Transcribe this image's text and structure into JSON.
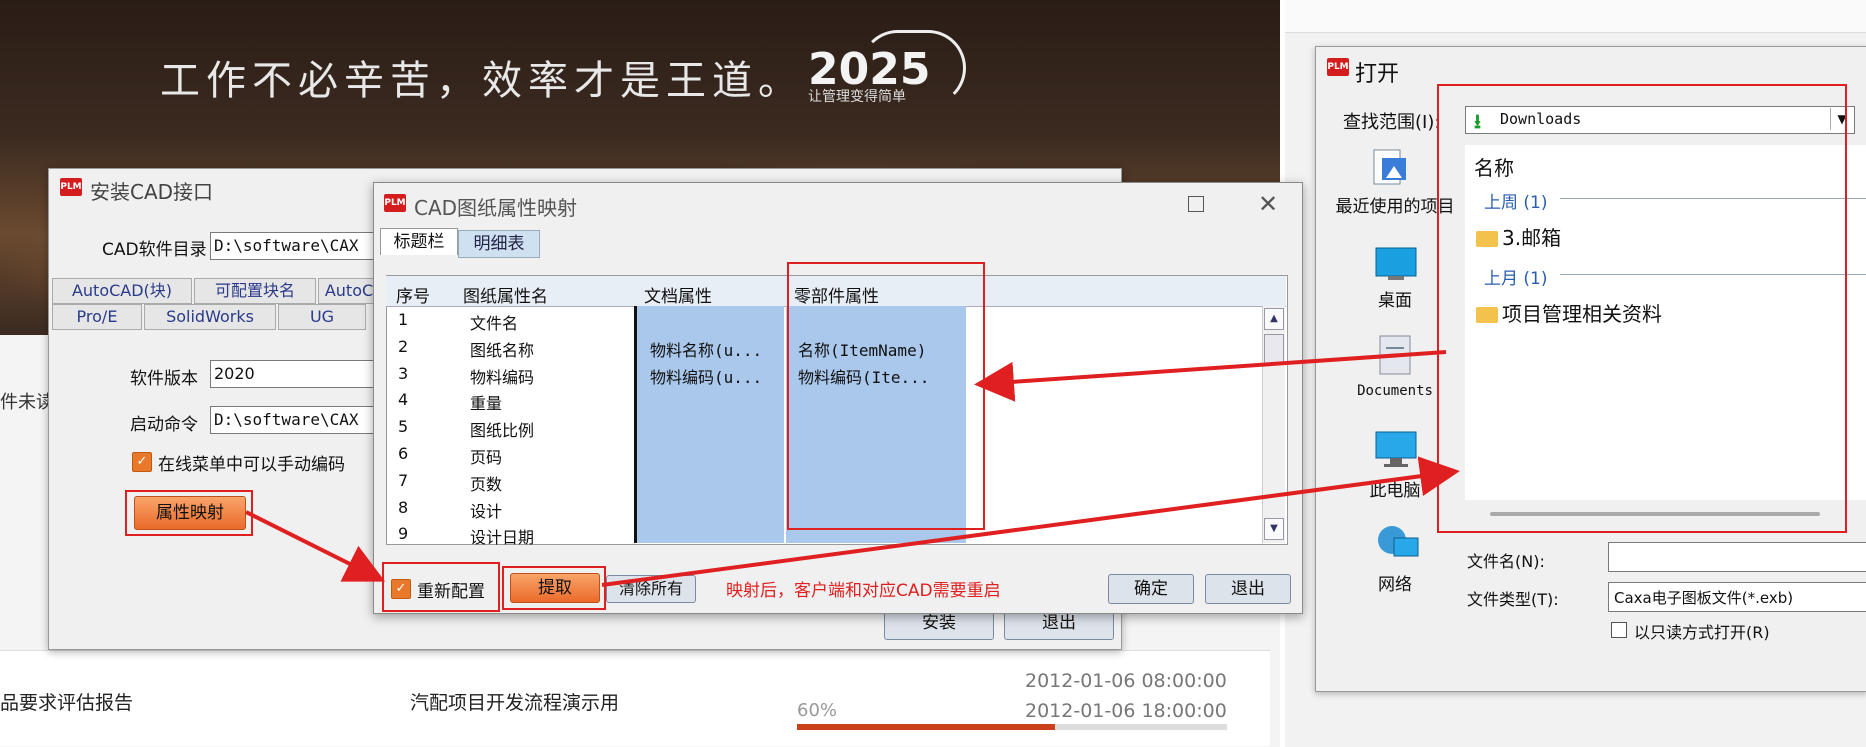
{
  "banner": {
    "slogan": "工作不必辛苦，效率才是王道。",
    "logo": "2025",
    "logo_sub": "让管理变得简单"
  },
  "background": {
    "left_item": "件未读",
    "row_col1": "品要求评估报告",
    "row_col2": "汽配项目开发流程演示用",
    "date1": "2012-01-06 08:00:00",
    "date2": "2012-01-06 18:00:00",
    "progress_label": "60%",
    "progress": 0.6,
    "accent": "#c9401a"
  },
  "open_dialog": {
    "title": "打开",
    "look_in_label": "查找范围(I):",
    "look_in_value": "Downloads",
    "places": [
      "最近使用的项目",
      "桌面",
      "Documents",
      "此电脑",
      "网络"
    ],
    "col_name": "名称",
    "group1": "上周 (1)",
    "folder1": "3.邮箱",
    "group2": "上月 (1)",
    "folder2": "项目管理相关资料",
    "filename_label": "文件名(N):",
    "filetype_label": "文件类型(T):",
    "filetype_value": "Caxa电子图板文件(*.exb)",
    "readonly_label": "以只读方式打开(R)"
  },
  "install_dialog": {
    "title": "安装CAD接口",
    "cad_dir_label": "CAD软件目录",
    "cad_dir_value": "D:\\software\\CAX",
    "tabs_row1": [
      "AutoCAD(块)",
      "可配置块名",
      "AutoC"
    ],
    "tabs_row2": [
      "Pro/E",
      "SolidWorks",
      "UG"
    ],
    "version_label": "软件版本",
    "version_value": "2020",
    "command_label": "启动命令",
    "command_value": "D:\\software\\CAX",
    "online_label": "在线菜单中可以手动编码",
    "attr_button": "属性映射",
    "install_button": "安装",
    "exit_button": "退出"
  },
  "map_dialog": {
    "title": "CAD图纸属性映射",
    "tab_active": "标题栏",
    "tab_2": "明细表",
    "headers": [
      "序号",
      "图纸属性名",
      "文档属性",
      "零部件属性"
    ],
    "rows": [
      [
        "1",
        "文件名",
        "",
        ""
      ],
      [
        "2",
        "图纸名称",
        "物料名称(u...",
        "名称(ItemName)"
      ],
      [
        "3",
        "物料编码",
        "物料编码(u...",
        "物料编码(Ite..."
      ],
      [
        "4",
        "重量",
        "",
        ""
      ],
      [
        "5",
        "图纸比例",
        "",
        ""
      ],
      [
        "6",
        "页码",
        "",
        ""
      ],
      [
        "7",
        "页数",
        "",
        ""
      ],
      [
        "8",
        "设计",
        "",
        ""
      ],
      [
        "9",
        "设计日期",
        "",
        ""
      ]
    ],
    "reconfig_label": "重新配置",
    "extract_button": "提取",
    "clear_button": "清除所有",
    "note": "映射后，客户端和对应CAD需要重启",
    "ok_button": "确定",
    "quit_button": "退出"
  }
}
